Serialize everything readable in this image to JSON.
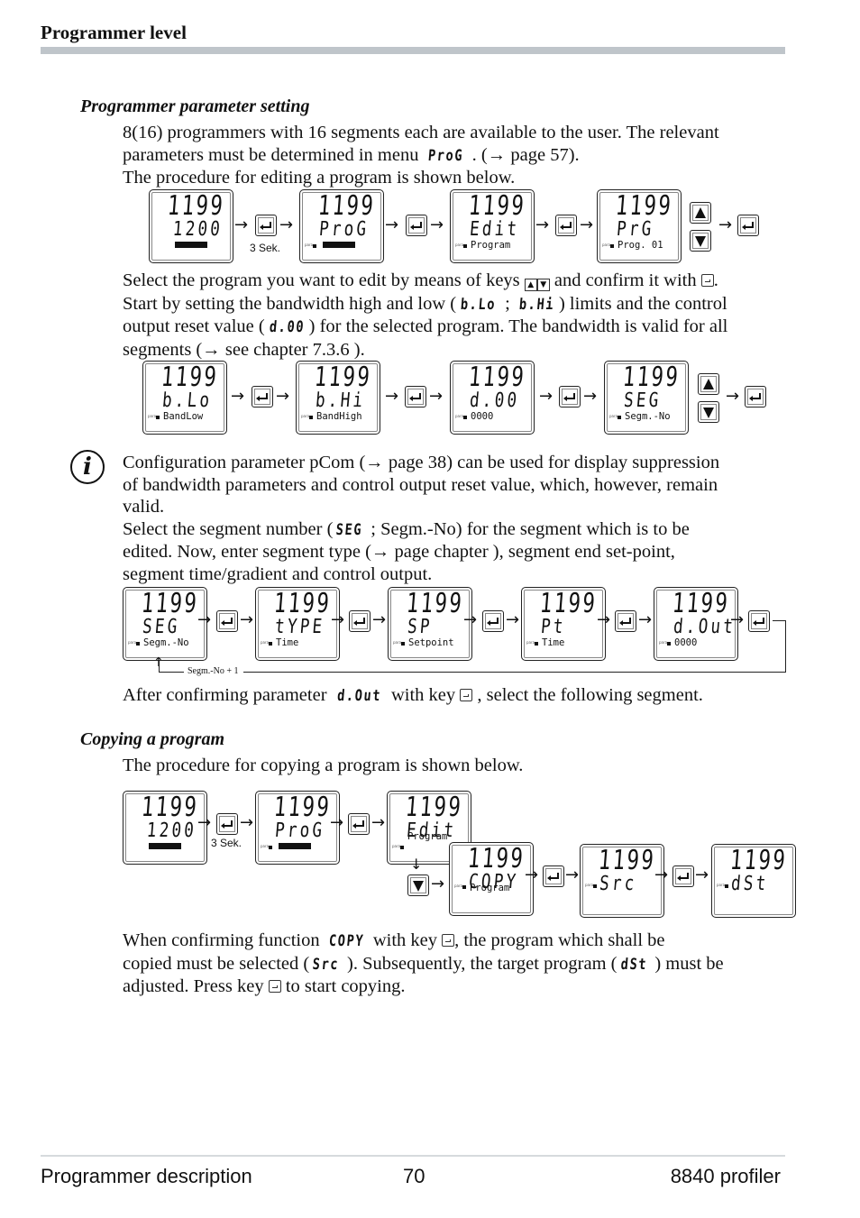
{
  "header": {
    "title": "Programmer level"
  },
  "section1": {
    "title": "Programmer parameter setting",
    "para1": {
      "line1": "8(16) programmers with 16 segments each are available to the user. The relevant",
      "line2_pre": "parameters must be determined in menu ",
      "line2_code": "ProG",
      "line2_post": " . (→ page 57).",
      "line3": "The procedure for editing a program is shown below."
    },
    "flow1": {
      "displays": [
        {
          "top": "1199",
          "mid": "1200",
          "label": "",
          "bar": true,
          "led": false
        },
        {
          "top": "1199",
          "mid": "ProG",
          "label": "",
          "bar": true,
          "led": true
        },
        {
          "top": "1199",
          "mid": "Edit",
          "label": "Program",
          "bar": false,
          "led": true
        },
        {
          "top": "1199",
          "mid": "PrG",
          "label": "Prog. 01",
          "bar": false,
          "led": true
        }
      ],
      "hold_label": "3 Sek."
    },
    "para2": {
      "l1_pre": "Select the program you want to edit by means of keys ",
      "l1_mid": " and confirm it with ",
      "l1_post": ".",
      "l2_pre": "Start by setting the bandwidth high and low (",
      "l2_code1": "b.Lo",
      "l2_sep": " ; ",
      "l2_code2": "b.Hi",
      "l2_post": ") limits and the control",
      "l3_pre": "output reset value (",
      "l3_code": "d.00",
      "l3_post": ") for the selected program. The bandwidth is valid for all",
      "l4": "segments (→ see chapter 7.3.6 )."
    },
    "flow2": {
      "displays": [
        {
          "top": "1199",
          "mid": "b.Lo",
          "label": "BandLow"
        },
        {
          "top": "1199",
          "mid": "b.Hi",
          "label": "BandHigh"
        },
        {
          "top": "1199",
          "mid": "d.00",
          "label": "0000"
        },
        {
          "top": "1199",
          "mid": "SEG",
          "label": "Segm.-No"
        }
      ]
    },
    "note": {
      "l1": "Configuration parameter pCom (→ page 38) can be used for display suppression",
      "l2": "of bandwidth parameters and control output reset value, which, however, remain",
      "l3": "valid.",
      "l4_pre": "Select the segment number (",
      "l4_code": "SEG",
      "l4_post": " ; Segm.-No) for the segment which is to be",
      "l5": "edited. Now, enter segment type (→ page  chapter ), segment end set-point,",
      "l6": "segment time/gradient and control output."
    },
    "flow3": {
      "displays": [
        {
          "top": "1199",
          "mid": "SEG",
          "label": "Segm.-No"
        },
        {
          "top": "1199",
          "mid": "tYPE",
          "label": "Time"
        },
        {
          "top": "1199",
          "mid": "SP",
          "label": "Setpoint"
        },
        {
          "top": "1199",
          "mid": "Pt",
          "label": "Time"
        },
        {
          "top": "1199",
          "mid": "d.Out",
          "label": "0000"
        }
      ],
      "loop_label": "Segm.-No + 1"
    },
    "para3": {
      "pre": "After confirming parameter ",
      "code": "d.Out",
      "mid": "  with key ",
      "post": " , select the following segment."
    }
  },
  "section2": {
    "title": "Copying a program",
    "intro": "The procedure for copying a program is shown below.",
    "flow": {
      "displays": [
        {
          "top": "1199",
          "mid": "1200",
          "label": ""
        },
        {
          "top": "1199",
          "mid": "ProG",
          "label": ""
        },
        {
          "top": "1199",
          "mid": "Edit",
          "label": "Program"
        },
        {
          "top": "1199",
          "mid": "COPY",
          "label": "Program"
        },
        {
          "top": "1199",
          "mid": "Src",
          "label": ""
        },
        {
          "top": "1199",
          "mid": "dSt",
          "label": ""
        }
      ],
      "hold_label": "3 Sek."
    },
    "para": {
      "l1_pre": "When confirming function ",
      "l1_code": "COPY",
      "l1_mid": "  with key ",
      "l1_post": ",  the program which shall be",
      "l2_pre": "copied must be selected (",
      "l2_code1": "Src",
      "l2_mid": " ). Subsequently, the target program (",
      "l2_code2": "dSt",
      "l2_post": " ) must be",
      "l3_pre": "adjusted. Press key ",
      "l3_post": " to start copying."
    }
  },
  "footer": {
    "left": "Programmer description",
    "page": "70",
    "right": "8840 profiler"
  },
  "icons": {
    "arrow": "→",
    "down_arrow": "↓",
    "up_key": "▲",
    "down_key": "▼",
    "info": "i"
  }
}
